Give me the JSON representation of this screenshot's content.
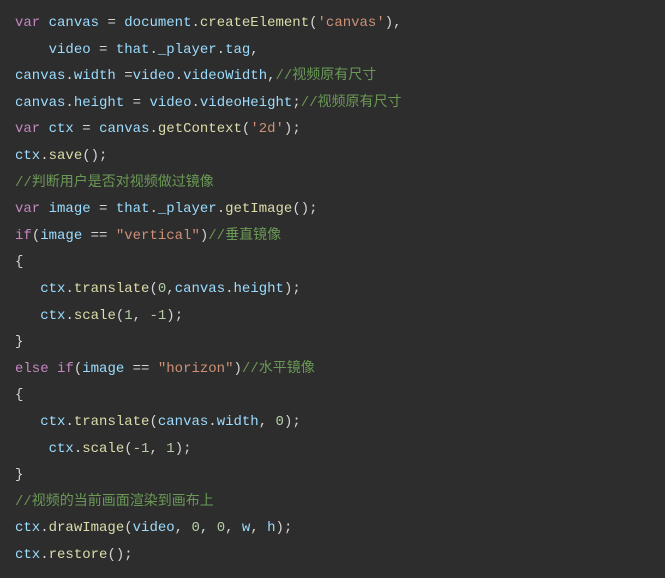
{
  "chart_data": null,
  "code": {
    "l1_var": "var",
    "l1_canvas": "canvas",
    "l1_eq": " = ",
    "l1_document": "document",
    "l1_dot": ".",
    "l1_createElement": "createElement",
    "l1_open": "(",
    "l1_str": "'canvas'",
    "l1_close": "),",
    "l2_indent": "    ",
    "l2_video": "video",
    "l2_eq": " = ",
    "l2_that": "that",
    "l2_dot1": ".",
    "l2_player": "_player",
    "l2_dot2": ".",
    "l2_tag": "tag",
    "l2_end": ",",
    "l3_canvas": "canvas",
    "l3_dot": ".",
    "l3_width": "width",
    "l3_eq": " =",
    "l3_video": "video",
    "l3_dot2": ".",
    "l3_videoWidth": "videoWidth",
    "l3_end": ",",
    "l3_comment": "//视频原有尺寸",
    "l4_canvas": "canvas",
    "l4_dot": ".",
    "l4_height": "height",
    "l4_eq": " = ",
    "l4_video": "video",
    "l4_dot2": ".",
    "l4_videoHeight": "videoHeight",
    "l4_end": ";",
    "l4_comment": "//视频原有尺寸",
    "l5_var": "var",
    "l5_ctx": "ctx",
    "l5_eq": " = ",
    "l5_canvas": "canvas",
    "l5_dot": ".",
    "l5_getContext": "getContext",
    "l5_open": "(",
    "l5_str": "'2d'",
    "l5_close": ");",
    "l6_ctx": "ctx",
    "l6_dot": ".",
    "l6_save": "save",
    "l6_end": "();",
    "l7_comment": "//判断用户是否对视频做过镜像",
    "l8_var": "var",
    "l8_image": "image",
    "l8_eq": " = ",
    "l8_that": "that",
    "l8_dot1": ".",
    "l8_player": "_player",
    "l8_dot2": ".",
    "l8_getImage": "getImage",
    "l8_end": "();",
    "l9_if": "if",
    "l9_open": "(",
    "l9_image": "image",
    "l9_eqeq": " == ",
    "l9_str": "\"vertical\"",
    "l9_close": ")",
    "l9_comment": "//垂直镜像",
    "l10_brace": "{",
    "l11_indent": "   ",
    "l11_ctx": "ctx",
    "l11_dot": ".",
    "l11_translate": "translate",
    "l11_open": "(",
    "l11_zero": "0",
    "l11_comma": ",",
    "l11_canvas": "canvas",
    "l11_dot2": ".",
    "l11_height": "height",
    "l11_close": ");",
    "l12_indent": "   ",
    "l12_ctx": "ctx",
    "l12_dot": ".",
    "l12_scale": "scale",
    "l12_open": "(",
    "l12_one": "1",
    "l12_comma": ", ",
    "l12_neg1": "-1",
    "l12_close": ");",
    "l13_brace": "}",
    "l14_else": "else",
    "l14_if": "if",
    "l14_open": "(",
    "l14_image": "image",
    "l14_eqeq": " == ",
    "l14_str": "\"horizon\"",
    "l14_close": ")",
    "l14_comment": "//水平镜像",
    "l15_brace": "{",
    "l16_indent": "   ",
    "l16_ctx": "ctx",
    "l16_dot": ".",
    "l16_translate": "translate",
    "l16_open": "(",
    "l16_canvas": "canvas",
    "l16_dot2": ".",
    "l16_width": "width",
    "l16_comma": ", ",
    "l16_zero": "0",
    "l16_close": ");",
    "l17_indent": "    ",
    "l17_ctx": "ctx",
    "l17_dot": ".",
    "l17_scale": "scale",
    "l17_open": "(",
    "l17_neg1": "-1",
    "l17_comma": ", ",
    "l17_one": "1",
    "l17_close": ");",
    "l18_brace": "}",
    "l19_comment": "//视频的当前画面渲染到画布上",
    "l20_ctx": "ctx",
    "l20_dot": ".",
    "l20_drawImage": "drawImage",
    "l20_open": "(",
    "l20_video": "video",
    "l20_c1": ", ",
    "l20_z1": "0",
    "l20_c2": ", ",
    "l20_z2": "0",
    "l20_c3": ", ",
    "l20_w": "w",
    "l20_c4": ", ",
    "l20_h": "h",
    "l20_close": ");",
    "l21_ctx": "ctx",
    "l21_dot": ".",
    "l21_restore": "restore",
    "l21_end": "();"
  }
}
